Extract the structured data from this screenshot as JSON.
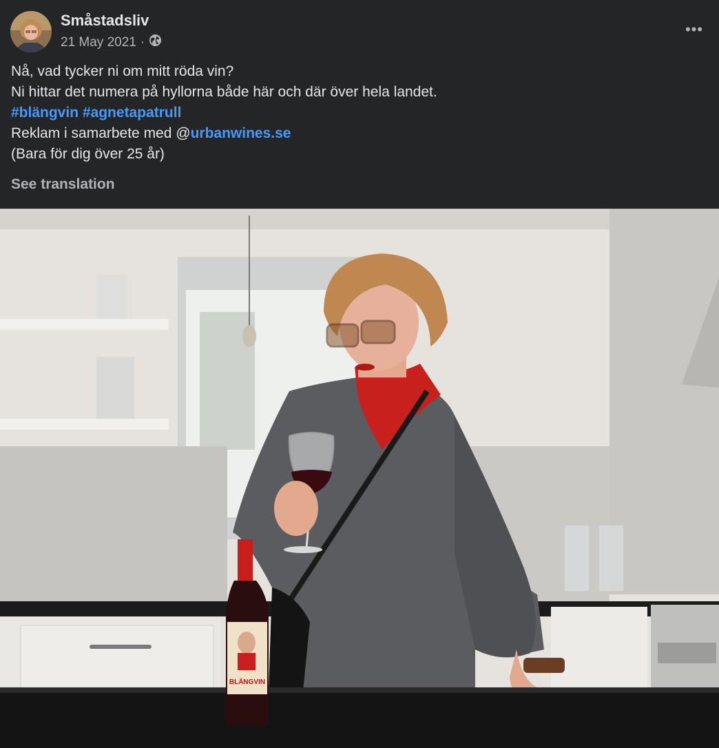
{
  "post": {
    "page_name": "Småstadsliv",
    "date": "21 May 2021",
    "separator": "·",
    "audience_icon": "globe-icon",
    "more_icon": "more-options-icon",
    "more_label": "•••",
    "text": {
      "line1": "Nå, vad tycker ni om mitt röda vin?",
      "line2": "Ni hittar det numera på hyllorna både här och där över hela landet.",
      "hashtag1": "#blängvin",
      "hashtag2": "#agnetapatrull",
      "line4_prefix": "Reklam i samarbete med @",
      "mention": "urbanwines.se",
      "line5": "(Bara för dig över 25 år)"
    },
    "see_translation": "See translation"
  },
  "photo": {
    "bottle_label_text": "BLÄNGVIN"
  },
  "colors": {
    "background": "#242526",
    "primary_text": "#e4e6eb",
    "secondary_text": "#b0b3b8",
    "link": "#4599ff"
  }
}
